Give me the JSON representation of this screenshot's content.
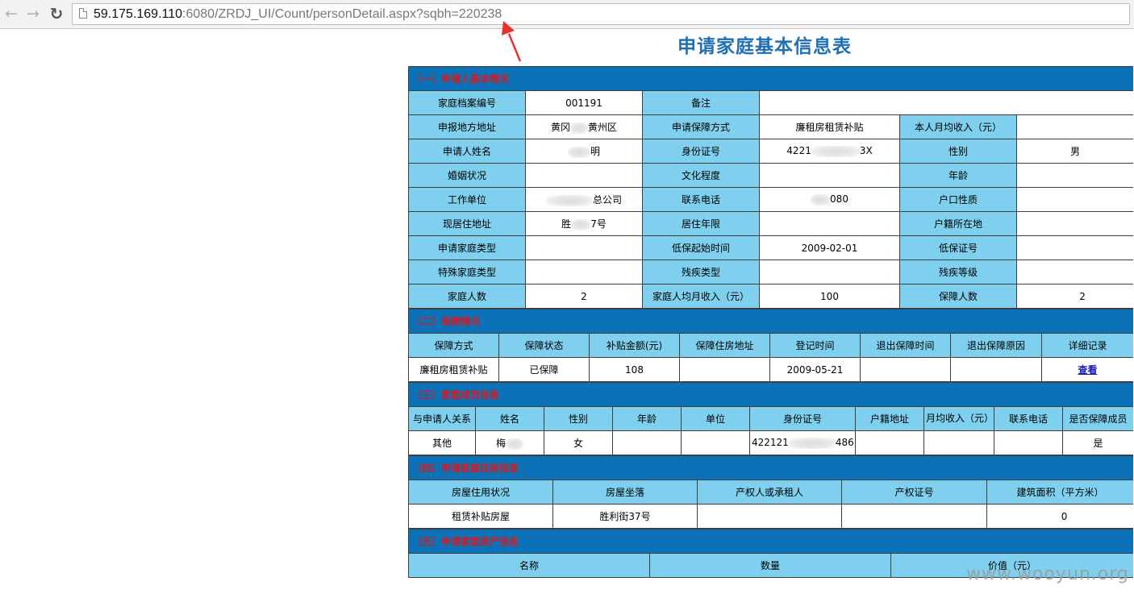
{
  "browser": {
    "back_icon": "back-arrow-icon",
    "forward_icon": "forward-arrow-icon",
    "reload_icon": "reload-icon",
    "url_host": "59.175.169.110",
    "url_rest": ":6080/ZRDJ_UI/Count/personDetail.aspx?sqbh=220238"
  },
  "page": {
    "title": "申请家庭基本信息表",
    "watermark": "www.wooyun.org",
    "annotation_color": "#e8332a",
    "header_color": "#0c72b8",
    "label_color": "#7fd0ee",
    "section_text_color": "#d9191e"
  },
  "section1": {
    "title": "（一）申请人基本情况",
    "rows": [
      {
        "l1": "家庭档案编号",
        "v1": "001191",
        "l2": "备注",
        "v2": "",
        "l3": "",
        "v3": ""
      },
      {
        "l1": "申报地方地址",
        "v1a": "黄冈",
        "v1b": "黄州区",
        "l2": "申请保障方式",
        "v2": "廉租房租赁补贴",
        "l3": "本人月均收入（元）",
        "v3": ""
      },
      {
        "l1": "申请人姓名",
        "v1b": "明",
        "l2": "身份证号",
        "v2a": "4221",
        "v2b": "3X",
        "l3": "性别",
        "v3": "男"
      },
      {
        "l1": "婚姻状况",
        "v1": "",
        "l2": "文化程度",
        "v2": "",
        "l3": "年龄",
        "v3": ""
      },
      {
        "l1": "工作单位",
        "v1b": "总公司",
        "l2": "联系电话",
        "v2b": "080",
        "l3": "户口性质",
        "v3": ""
      },
      {
        "l1": "现居住地址",
        "v1a": "胜",
        "v1b": "7号",
        "l2": "居住年限",
        "v2": "",
        "l3": "户籍所在地",
        "v3": ""
      },
      {
        "l1": "申请家庭类型",
        "v1": "",
        "l2": "低保起始时间",
        "v2": "2009-02-01",
        "l3": "低保证号",
        "v3": ""
      },
      {
        "l1": "特殊家庭类型",
        "v1": "",
        "l2": "残疾类型",
        "v2": "",
        "l3": "残疾等级",
        "v3": ""
      },
      {
        "l1": "家庭人数",
        "v1": "2",
        "l2": "家庭人均月收入（元）",
        "v2": "100",
        "l3": "保障人数",
        "v3": "2"
      }
    ]
  },
  "section2": {
    "title": "（二）保障情况",
    "headers": [
      "保障方式",
      "保障状态",
      "补贴金额(元)",
      "保障住房地址",
      "登记时间",
      "退出保障时间",
      "退出保障原因",
      "详细记录"
    ],
    "row": [
      "廉租房租赁补贴",
      "已保障",
      "108",
      "",
      "2009-05-21",
      "",
      "",
      ""
    ],
    "link": "查看"
  },
  "section3": {
    "title": "（三）家庭成员信息",
    "headers": [
      "与申请人关系",
      "姓名",
      "性别",
      "年龄",
      "单位",
      "身份证号",
      "户籍地址",
      "月均收入（元）",
      "联系电话",
      "是否保障成员"
    ],
    "row": {
      "relation": "其他",
      "name": "梅",
      "gender": "女",
      "age": "",
      "unit": "",
      "id_a": "422121",
      "id_b": "486",
      "address": "",
      "income": "",
      "phone": "",
      "covered": "是"
    }
  },
  "section4": {
    "title": "（四）申请家庭住房信息",
    "headers": [
      "房屋住用状况",
      "房屋坐落",
      "产权人或承租人",
      "产权证号",
      "建筑面积（平方米）"
    ],
    "row": [
      "租赁补贴房屋",
      "胜利街37号",
      "",
      "",
      "0"
    ]
  },
  "section5": {
    "title": "（五）申请家庭资产信息",
    "headers": [
      "名称",
      "数量",
      "价值（元）"
    ]
  }
}
